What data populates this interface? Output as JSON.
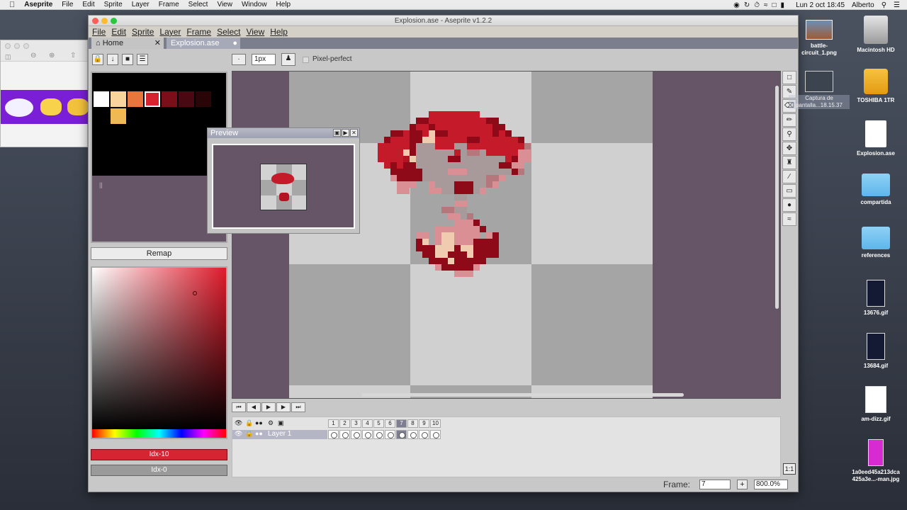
{
  "mac_menubar": {
    "apple": "",
    "app": "Aseprite",
    "items": [
      "File",
      "Edit",
      "Sprite",
      "Layer",
      "Frame",
      "Select",
      "View",
      "Window",
      "Help"
    ],
    "datetime": "Lun 2 oct  18:45",
    "user": "Alberto"
  },
  "window": {
    "title": "Explosion.ase - Aseprite v1.2.2"
  },
  "app_menu": [
    "File",
    "Edit",
    "Sprite",
    "Layer",
    "Frame",
    "Select",
    "View",
    "Help"
  ],
  "tabs": [
    {
      "label": "Home"
    },
    {
      "label": "Explosion.ase"
    }
  ],
  "context_bar": {
    "brush_size": "1px",
    "pixel_perfect": "Pixel-perfect"
  },
  "palette": {
    "swatches": [
      "#ffffff",
      "#f9d49c",
      "#e9763c",
      "#d7232f",
      "#7a0f1a",
      "#4a0912",
      "#2a0508",
      "#f1b954"
    ],
    "selected_index": 3
  },
  "remap_label": "Remap",
  "color": {
    "fg_label": "Idx-10",
    "fg_hex": "#d62433",
    "bg_label": "Idx-0"
  },
  "preview": {
    "title": "Preview"
  },
  "timeline": {
    "layer_name": "Layer 1",
    "frames": [
      "1",
      "2",
      "3",
      "4",
      "5",
      "6",
      "7",
      "8",
      "9",
      "10"
    ],
    "current_frame_index": 6
  },
  "status": {
    "frame_label": "Frame:",
    "frame_value": "7",
    "zoom": "800.0%"
  },
  "desktop_icons": [
    {
      "label": "battle-\ncircuit_1.png"
    },
    {
      "label": "Macintosh HD"
    },
    {
      "label": "Captura de\npantalla...18.15.37"
    },
    {
      "label": "TOSHIBA 1TR"
    },
    {
      "label": "Explosion.ase"
    },
    {
      "label": "compartida"
    },
    {
      "label": "references"
    },
    {
      "label": "13676.gif"
    },
    {
      "label": "13684.gif"
    },
    {
      "label": "am-dizz.gif"
    },
    {
      "label": "1a0eed45a213dca\n425a3e...-man.jpg"
    }
  ]
}
